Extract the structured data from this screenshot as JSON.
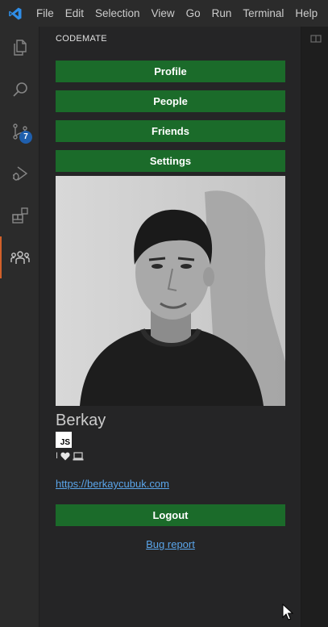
{
  "menu": [
    "File",
    "Edit",
    "Selection",
    "View",
    "Go",
    "Run",
    "Terminal",
    "Help"
  ],
  "activity_bar": {
    "items": [
      {
        "icon": "files-icon"
      },
      {
        "icon": "search-icon"
      },
      {
        "icon": "source-control-icon",
        "badge": "7"
      },
      {
        "icon": "run-debug-icon"
      },
      {
        "icon": "extensions-icon"
      },
      {
        "icon": "people-icon",
        "active": true
      }
    ]
  },
  "sidebar": {
    "title": "CODEMATE",
    "buttons": {
      "profile": "Profile",
      "people": "People",
      "friends": "Friends",
      "settings": "Settings"
    },
    "profile": {
      "name": "Berkay",
      "language_badge": "JS",
      "bio_prefix": "I",
      "bio_icons": [
        "heart-icon",
        "laptop-icon"
      ],
      "website": "https://berkaycubuk.com"
    },
    "logout": "Logout",
    "bug_report": "Bug report"
  },
  "colors": {
    "button_bg": "#1b6b2a",
    "link": "#5aa5ea",
    "badge_bg": "#1f5fad",
    "active_indicator": "#d2602a"
  }
}
